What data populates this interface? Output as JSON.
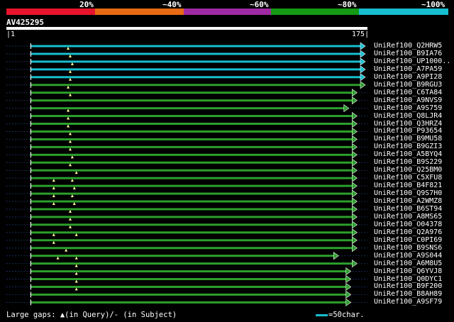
{
  "identity_scale": {
    "segments": [
      {
        "label": "20%",
        "color": "#e8142d"
      },
      {
        "label": "~40%",
        "color": "#e86a14"
      },
      {
        "label": "~60%",
        "color": "#9f2aa3"
      },
      {
        "label": "~80%",
        "color": "#149a14"
      },
      {
        "label": "~100%",
        "color": "#17becf"
      }
    ]
  },
  "query": {
    "name": "AV425295",
    "start": "1",
    "end": "175"
  },
  "legend": {
    "gaps_text": "Large gaps: ▲(in Query)/- (in Subject)",
    "scale_text": "=50char."
  },
  "chart_data": {
    "type": "alignment-overview",
    "query_length": 175,
    "colors": {
      "cyan": "#17becf",
      "green": "#2ca02c",
      "subject_gap": "#17becf"
    },
    "hits": [
      {
        "label": "UniRef100_Q2HRW5",
        "start": 13,
        "end": 175,
        "color": "cyan",
        "gaps": []
      },
      {
        "label": "UniRef100_B9IA76",
        "start": 13,
        "end": 175,
        "color": "cyan",
        "gaps": [
          31
        ]
      },
      {
        "label": "UniRef100_UP1000..",
        "start": 13,
        "end": 175,
        "color": "cyan",
        "gaps": [
          32
        ]
      },
      {
        "label": "UniRef100_A7PA59",
        "start": 13,
        "end": 175,
        "color": "cyan",
        "gaps": [
          33
        ]
      },
      {
        "label": "UniRef100_A9PI28",
        "start": 13,
        "end": 175,
        "color": "cyan",
        "gaps": [
          32
        ]
      },
      {
        "label": "UniRef100_B9RGU3",
        "start": 13,
        "end": 175,
        "color": "green",
        "gaps": [
          32
        ]
      },
      {
        "label": "UniRef100_C6TA84",
        "start": 13,
        "end": 171,
        "color": "green",
        "gaps": [
          31
        ]
      },
      {
        "label": "UniRef100_A9NVS9",
        "start": 13,
        "end": 171,
        "color": "green",
        "gaps": [
          32
        ]
      },
      {
        "label": "UniRef100_A9S759",
        "start": 13,
        "end": 167,
        "color": "green",
        "gaps": []
      },
      {
        "label": "UniRef100_Q8LJR4",
        "start": 13,
        "end": 171,
        "color": "green",
        "gaps": [
          31
        ]
      },
      {
        "label": "UniRef100_Q3HRZ4",
        "start": 13,
        "end": 171,
        "color": "green",
        "gaps": [
          31
        ]
      },
      {
        "label": "UniRef100_P93654",
        "start": 13,
        "end": 171,
        "color": "green",
        "gaps": [
          31
        ]
      },
      {
        "label": "UniRef100_B9MU58",
        "start": 13,
        "end": 171,
        "color": "green",
        "gaps": [
          32
        ]
      },
      {
        "label": "UniRef100_B9GZI3",
        "start": 13,
        "end": 171,
        "color": "green",
        "gaps": [
          32
        ]
      },
      {
        "label": "UniRef100_A5BYQ4",
        "start": 13,
        "end": 171,
        "color": "green",
        "gaps": [
          32
        ]
      },
      {
        "label": "UniRef100_B9S229",
        "start": 13,
        "end": 171,
        "color": "green",
        "gaps": [
          33
        ]
      },
      {
        "label": "UniRef100_Q25BM0",
        "start": 13,
        "end": 171,
        "color": "green",
        "gaps": [
          32
        ]
      },
      {
        "label": "UniRef100_C5XFU8",
        "start": 13,
        "end": 171,
        "color": "green",
        "gaps": [
          35
        ]
      },
      {
        "label": "UniRef100_B4F821",
        "start": 13,
        "end": 171,
        "color": "green",
        "gaps": [
          24,
          33
        ]
      },
      {
        "label": "UniRef100_Q9S7H0",
        "start": 13,
        "end": 171,
        "color": "green",
        "gaps": [
          24,
          34
        ]
      },
      {
        "label": "UniRef100_A2WMZ8",
        "start": 13,
        "end": 171,
        "color": "green",
        "gaps": [
          24,
          33
        ]
      },
      {
        "label": "UniRef100_B6ST94",
        "start": 13,
        "end": 171,
        "color": "green",
        "gaps": [
          24,
          34
        ]
      },
      {
        "label": "UniRef100_A8MS65",
        "start": 13,
        "end": 171,
        "color": "green",
        "gaps": [
          32
        ]
      },
      {
        "label": "UniRef100_O04378",
        "start": 13,
        "end": 171,
        "color": "green",
        "gaps": [
          32
        ]
      },
      {
        "label": "UniRef100_Q2A976",
        "start": 13,
        "end": 171,
        "color": "green",
        "gaps": [
          32
        ]
      },
      {
        "label": "UniRef100_C0PI69",
        "start": 13,
        "end": 171,
        "color": "green",
        "gaps": [
          24,
          35
        ]
      },
      {
        "label": "UniRef100_B9SNS6",
        "start": 13,
        "end": 171,
        "color": "green",
        "gaps": [
          24
        ]
      },
      {
        "label": "UniRef100_A9S044",
        "start": 13,
        "end": 162,
        "color": "green",
        "gaps": [
          30
        ]
      },
      {
        "label": "UniRef100_A6M8U5",
        "start": 13,
        "end": 171,
        "color": "green",
        "gaps": [
          26,
          35
        ]
      },
      {
        "label": "UniRef100_Q6YVJ8",
        "start": 13,
        "end": 168,
        "color": "green",
        "gaps": [
          35
        ]
      },
      {
        "label": "UniRef100_Q0DYC1",
        "start": 13,
        "end": 168,
        "color": "green",
        "gaps": [
          35
        ]
      },
      {
        "label": "UniRef100_B9F200",
        "start": 13,
        "end": 168,
        "color": "green",
        "gaps": [
          35
        ]
      },
      {
        "label": "UniRef100_B8AH89",
        "start": 13,
        "end": 168,
        "color": "green",
        "gaps": [
          35
        ]
      },
      {
        "label": "UniRef100_A9SF79",
        "start": 13,
        "end": 168,
        "color": "green",
        "gaps": []
      }
    ]
  }
}
